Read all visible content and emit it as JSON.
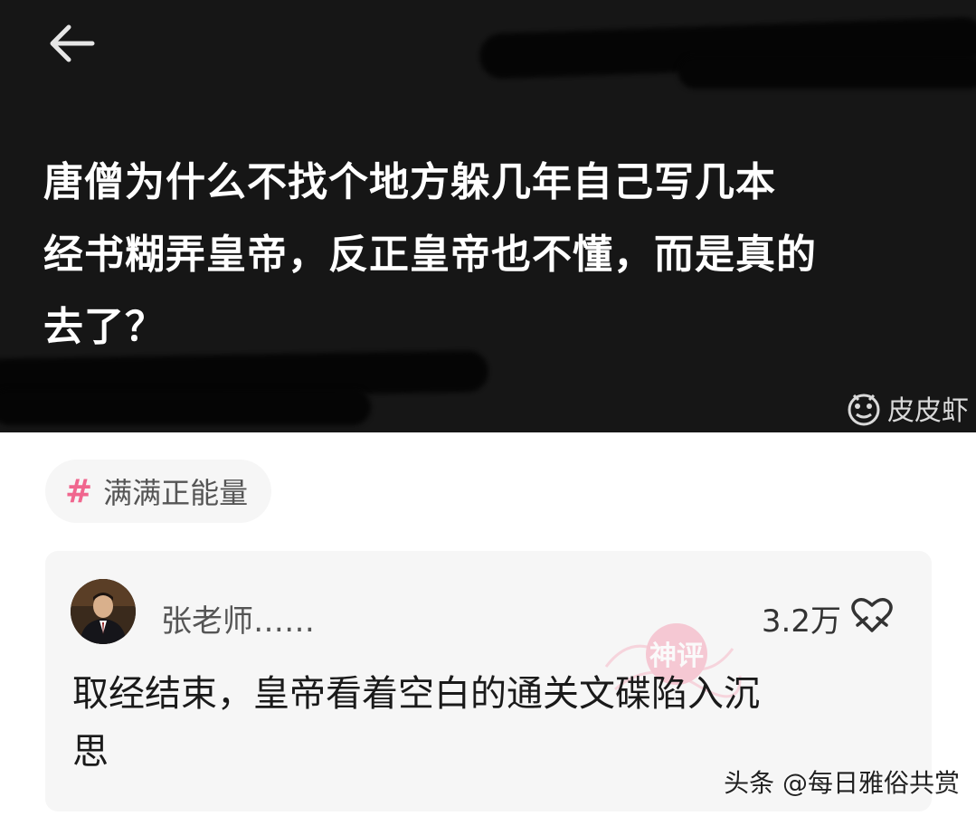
{
  "header": {
    "back_label": "back",
    "question_lines": [
      "唐僧为什么不找个地方躲几年自己写几本",
      "经书糊弄皇帝，反正皇帝也不懂，而是真的",
      "去了？"
    ],
    "background_color": "#161616"
  },
  "watermark_app": {
    "label": "皮皮虾",
    "icon": "pipixia-logo-icon"
  },
  "tag": {
    "icon": "hash-icon",
    "label": "满满正能量",
    "accent_color": "#f0668e"
  },
  "comment": {
    "username": "张老师……",
    "likes": "3.2万",
    "like_icon": "heart-hands-icon",
    "stamp_text": "神评",
    "text_lines": [
      "取经结束，皇帝看着空白的通关文碟陷入沉",
      "思"
    ]
  },
  "watermark_source": {
    "label": "头条 @每日雅俗共赏"
  }
}
